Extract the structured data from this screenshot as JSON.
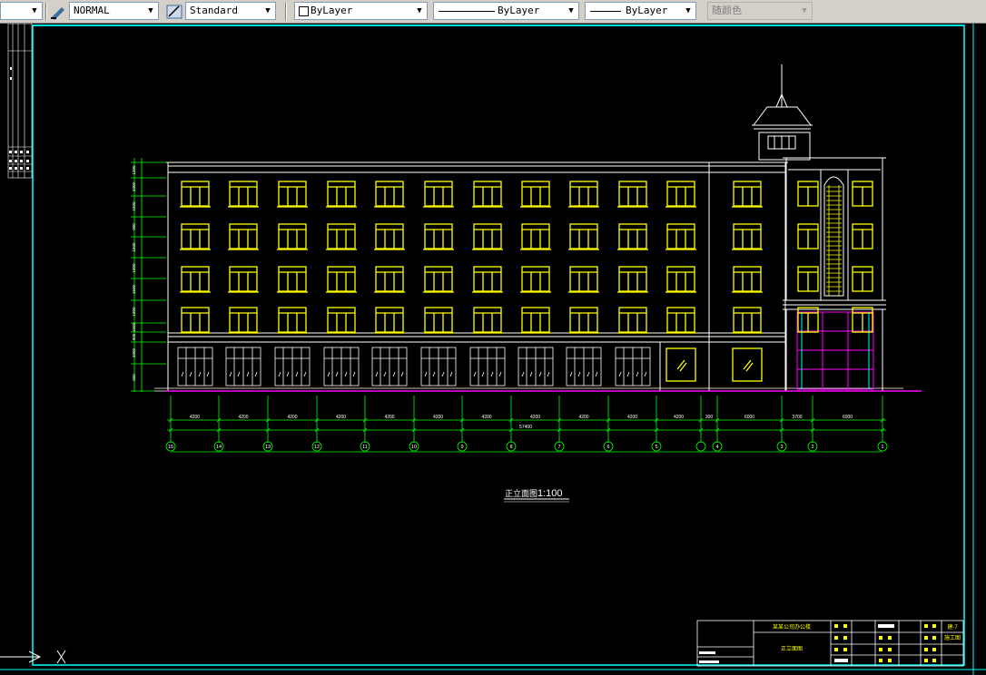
{
  "toolbar": {
    "first_combo_value": "",
    "text_style": "NORMAL",
    "dim_style": "Standard",
    "layer_color": "ByLayer",
    "linetype": "ByLayer",
    "lineweight": "ByLayer",
    "plot_style": "随颜色"
  },
  "drawing": {
    "caption": "正立面图",
    "scale": "1:100",
    "bay_dimensions": [
      "4200",
      "4200",
      "4200",
      "4200",
      "4200",
      "4200",
      "4200",
      "4200",
      "4200",
      "4200",
      "4200",
      "300",
      "6000",
      "3700",
      "6000"
    ],
    "overall_dimension": "57400",
    "axis_labels": [
      "15",
      "14",
      "13",
      "12",
      "11",
      "10",
      "9",
      "8",
      "7",
      "6",
      "5",
      "4",
      "3",
      "2",
      "1"
    ],
    "level_marks": [
      "1200",
      "3300",
      "1500",
      "900",
      "1500",
      "1800",
      "1500",
      "1800",
      "1500",
      "900",
      "3300",
      "900"
    ],
    "title_block": {
      "project": "某某公司办公楼",
      "drawing_name": "正立面图",
      "sheet_no": "建-7",
      "phase": "施工图"
    }
  }
}
